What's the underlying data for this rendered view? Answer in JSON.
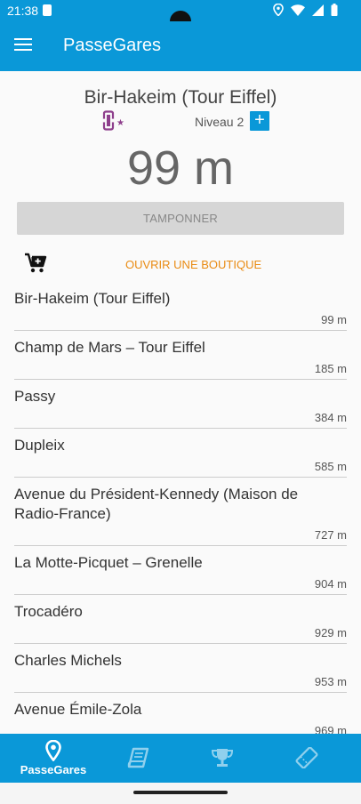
{
  "status_bar": {
    "time": "21:38"
  },
  "app_bar": {
    "title": "PasseGares"
  },
  "station": {
    "name": "Bir-Hakeim (Tour Eiffel)",
    "level_label": "Niveau 2",
    "level_add_symbol": "+",
    "distance": "99 m",
    "ticket_icon_star": "★"
  },
  "actions": {
    "stamp_label": "TAMPONNER",
    "shop_label": "OUVRIR UNE BOUTIQUE"
  },
  "nearby": [
    {
      "name": "Bir-Hakeim (Tour Eiffel)",
      "distance": "99 m"
    },
    {
      "name": "Champ de Mars – Tour Eiffel",
      "distance": "185 m"
    },
    {
      "name": "Passy",
      "distance": "384 m"
    },
    {
      "name": "Dupleix",
      "distance": "585 m"
    },
    {
      "name": "Avenue du Président-Kennedy (Maison de Radio-France)",
      "distance": "727 m"
    },
    {
      "name": "La Motte-Picquet – Grenelle",
      "distance": "904 m"
    },
    {
      "name": "Trocadéro",
      "distance": "929 m"
    },
    {
      "name": "Charles Michels",
      "distance": "953 m"
    },
    {
      "name": "Avenue Émile-Zola",
      "distance": "969 m"
    }
  ],
  "bottom_nav": {
    "items": [
      {
        "label": "PasseGares",
        "icon": "map-pin-icon",
        "active": true
      },
      {
        "label": "",
        "icon": "book-icon",
        "active": false
      },
      {
        "label": "",
        "icon": "trophy-icon",
        "active": false
      },
      {
        "label": "",
        "icon": "ticket-icon",
        "active": false
      }
    ]
  },
  "colors": {
    "primary": "#0a98d8",
    "accent": "#e98b13",
    "ticket_purple": "#8e3f8c",
    "disabled_button": "#d6d6d6"
  }
}
